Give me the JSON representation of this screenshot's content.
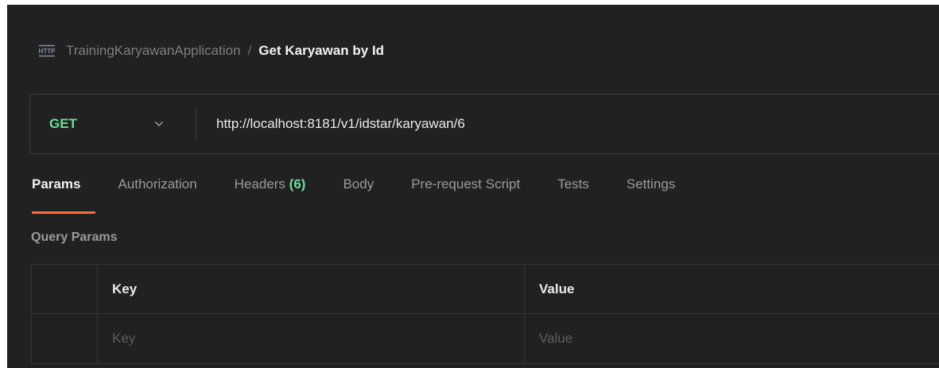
{
  "breadcrumb": {
    "icon": "http-request-icon",
    "parent": "TrainingKaryawanApplication",
    "separator": "/",
    "current": "Get Karyawan by Id"
  },
  "request": {
    "method": "GET",
    "method_color": "#6bdd9a",
    "url": "http://localhost:8181/v1/idstar/karyawan/6"
  },
  "tabs": [
    {
      "label": "Params",
      "active": true
    },
    {
      "label": "Authorization"
    },
    {
      "label": "Headers",
      "count": "(6)"
    },
    {
      "label": "Body"
    },
    {
      "label": "Pre-request Script"
    },
    {
      "label": "Tests"
    },
    {
      "label": "Settings"
    }
  ],
  "accent_color": "#ff6c37",
  "query_params": {
    "title": "Query Params",
    "columns": [
      "Key",
      "Value"
    ],
    "placeholders": {
      "key": "Key",
      "value": "Value"
    }
  }
}
